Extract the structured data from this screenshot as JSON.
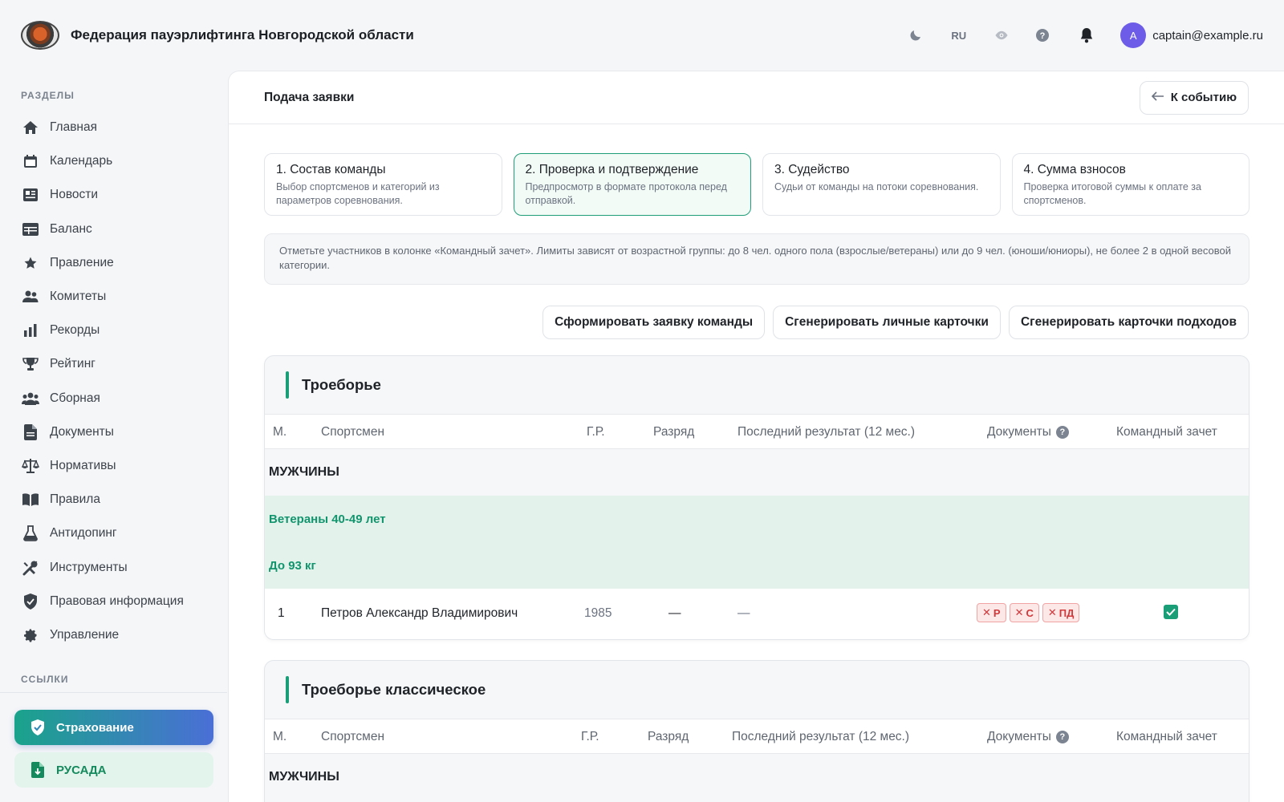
{
  "header": {
    "brand": "Федерация пауэрлифтинга Новгородской области",
    "lang": "RU",
    "avatar_letter": "A",
    "user_email": "captain@example.ru"
  },
  "sidebar": {
    "section_title": "РАЗДЕЛЫ",
    "items": [
      {
        "label": "Главная",
        "icon": "home-icon"
      },
      {
        "label": "Календарь",
        "icon": "calendar-icon"
      },
      {
        "label": "Новости",
        "icon": "news-icon"
      },
      {
        "label": "Баланс",
        "icon": "balance-icon"
      },
      {
        "label": "Правление",
        "icon": "star-icon"
      },
      {
        "label": "Комитеты",
        "icon": "users-icon"
      },
      {
        "label": "Рекорды",
        "icon": "bar-chart-icon"
      },
      {
        "label": "Рейтинг",
        "icon": "trophy-icon"
      },
      {
        "label": "Сборная",
        "icon": "team-icon"
      },
      {
        "label": "Документы",
        "icon": "document-icon"
      },
      {
        "label": "Нормативы",
        "icon": "scales-icon"
      },
      {
        "label": "Правила",
        "icon": "book-icon"
      },
      {
        "label": "Антидопинг",
        "icon": "flask-icon"
      },
      {
        "label": "Инструменты",
        "icon": "tools-icon"
      },
      {
        "label": "Правовая информация",
        "icon": "shield-icon"
      },
      {
        "label": "Управление",
        "icon": "gear-icon"
      }
    ],
    "links_title": "ССЫЛКИ",
    "links": [
      {
        "label": "Страхование",
        "icon": "shield-check-icon"
      },
      {
        "label": "РУСАДА",
        "icon": "file-icon"
      }
    ]
  },
  "main": {
    "title": "Подача заявки",
    "back_label": "К событию",
    "steps": [
      {
        "title": "1. Состав команды",
        "desc": "Выбор спортсменов и категорий из параметров соревнования."
      },
      {
        "title": "2. Проверка и подтверждение",
        "desc": "Предпросмотр в формате протокола перед отправкой."
      },
      {
        "title": "3. Судейство",
        "desc": "Судьи от команды на потоки соревнования."
      },
      {
        "title": "4. Сумма взносов",
        "desc": "Проверка итоговой суммы к оплате за спортсменов."
      }
    ],
    "active_step": 1,
    "notice": "Отметьте участников в колонке «Командный зачет». Лимиты зависят от возрастной группы: до 8 чел. одного пола (взрослые/ветераны) или до 9 чел. (юноши/юниоры), не более 2 в одной весовой категории.",
    "actions": [
      "Сформировать заявку команды",
      "Сгенерировать личные карточки",
      "Сгенерировать карточки подходов"
    ],
    "columns": [
      "М.",
      "Спортсмен",
      "Г.Р.",
      "Разряд",
      "Последний результат (12 мес.)",
      "Документы",
      "Командный зачет"
    ],
    "cards": [
      {
        "title": "Троеборье",
        "group": "МУЖЧИНЫ",
        "age_group": "Ветераны 40-49 лет",
        "weight": "До 93 кг",
        "row": {
          "place": "1",
          "athlete": "Петров Александр Владимирович",
          "birth_year": "1985",
          "rank": "—",
          "last_result": "—",
          "docs": [
            "Р",
            "С",
            "ПД"
          ],
          "team_score": true
        }
      },
      {
        "title": "Троеборье классическое",
        "group": "МУЖЧИНЫ"
      }
    ]
  },
  "colors": {
    "accent": "#1a9e77",
    "badge_error": "#d1383a",
    "avatar": "#6c5ce7"
  }
}
